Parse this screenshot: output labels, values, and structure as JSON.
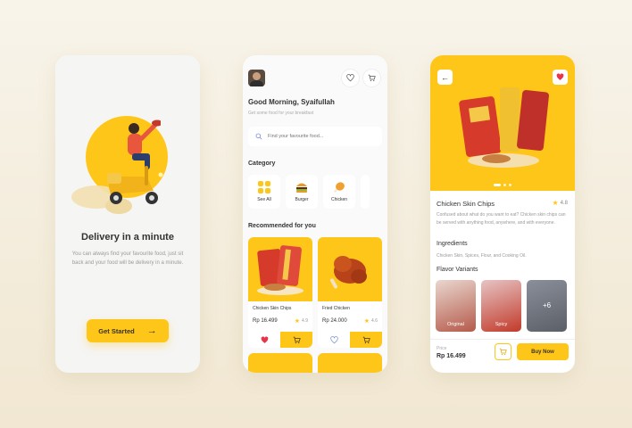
{
  "onboarding": {
    "title": "Delivery in a minute",
    "description": "You can always find your favourite food, just sit back and your food will be delivery in a minute.",
    "cta_label": "Get Started"
  },
  "home": {
    "greeting": "Good Morning, Syaifullah",
    "subtitle": "Get some food for your breakfast",
    "search_placeholder": "Find your favourite food...",
    "category_title": "Category",
    "categories": [
      {
        "label": "See All",
        "icon": "grid-icon"
      },
      {
        "label": "Burger",
        "icon": "burger-icon"
      },
      {
        "label": "Chicken",
        "icon": "chicken-icon"
      }
    ],
    "recommended_title": "Recommended for you",
    "products": [
      {
        "name": "Chicken Skin Chips",
        "price": "Rp 16.499",
        "rating": "4.9",
        "favorited": true
      },
      {
        "name": "Fried Chicken",
        "price": "Rp 24.000",
        "rating": "4.6",
        "favorited": false
      }
    ]
  },
  "detail": {
    "title": "Chicken Skin Chips",
    "rating": "4.8",
    "description": "Confused about what do you want to eat? Chicken skin chips can be served with anything food, anywhere, and with everyone.",
    "ingredients_title": "Ingredients",
    "ingredients": "Chicken Skin, Spices, Flour, and Cooking Oil.",
    "variants_title": "Flavor Variants",
    "variants": [
      {
        "label": "Original"
      },
      {
        "label": "Spicy"
      },
      {
        "label": "+6"
      }
    ],
    "price_label": "Price",
    "price": "Rp 16.499",
    "buy_label": "Buy Now"
  },
  "colors": {
    "accent": "#ffc61a",
    "heart": "#e8354a"
  }
}
